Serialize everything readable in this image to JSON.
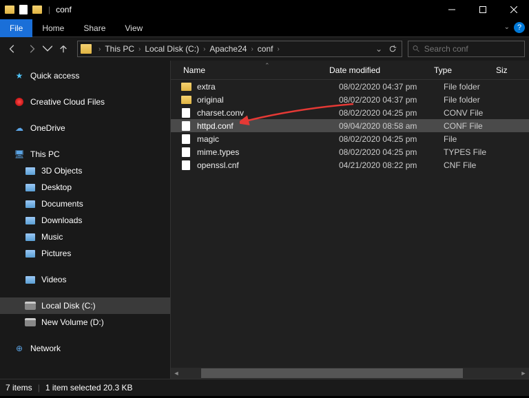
{
  "window": {
    "title": "conf"
  },
  "menu": {
    "file": "File",
    "home": "Home",
    "share": "Share",
    "view": "View"
  },
  "breadcrumbs": [
    "This PC",
    "Local Disk (C:)",
    "Apache24",
    "conf"
  ],
  "search": {
    "placeholder": "Search conf"
  },
  "sidebar": {
    "quick_access": "Quick access",
    "creative_cloud": "Creative Cloud Files",
    "onedrive": "OneDrive",
    "this_pc": "This PC",
    "objects_3d": "3D Objects",
    "desktop": "Desktop",
    "documents": "Documents",
    "downloads": "Downloads",
    "music": "Music",
    "pictures": "Pictures",
    "videos": "Videos",
    "local_disk": "Local Disk (C:)",
    "new_volume": "New Volume (D:)",
    "network": "Network"
  },
  "columns": {
    "name": "Name",
    "date": "Date modified",
    "type": "Type",
    "size": "Siz"
  },
  "files": [
    {
      "icon": "folder",
      "name": "extra",
      "date": "08/02/2020 04:37 pm",
      "type": "File folder",
      "selected": false
    },
    {
      "icon": "folder",
      "name": "original",
      "date": "08/02/2020 04:37 pm",
      "type": "File folder",
      "selected": false
    },
    {
      "icon": "file",
      "name": "charset.conv",
      "date": "08/02/2020 04:25 pm",
      "type": "CONV File",
      "selected": false
    },
    {
      "icon": "file",
      "name": "httpd.conf",
      "date": "09/04/2020 08:58 am",
      "type": "CONF File",
      "selected": true
    },
    {
      "icon": "file",
      "name": "magic",
      "date": "08/02/2020 04:25 pm",
      "type": "File",
      "selected": false
    },
    {
      "icon": "file",
      "name": "mime.types",
      "date": "08/02/2020 04:25 pm",
      "type": "TYPES File",
      "selected": false
    },
    {
      "icon": "file",
      "name": "openssl.cnf",
      "date": "04/21/2020 08:22 pm",
      "type": "CNF File",
      "selected": false
    }
  ],
  "status": {
    "count": "7 items",
    "selection": "1 item selected  20.3 KB"
  }
}
